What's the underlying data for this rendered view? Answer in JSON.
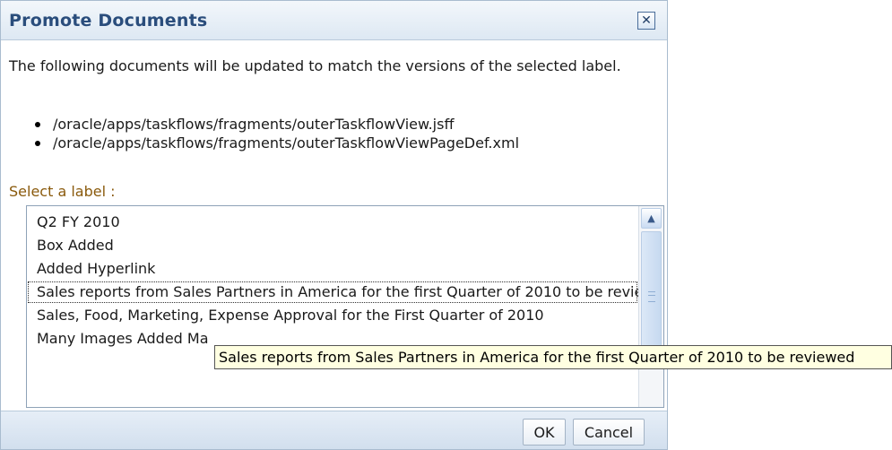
{
  "dialog": {
    "title": "Promote Documents",
    "close_icon": "close-icon",
    "description": "The following documents will be updated to match the versions of the selected label.",
    "documents": [
      "/oracle/apps/taskflows/fragments/outerTaskflowView.jsff",
      "/oracle/apps/taskflows/fragments/outerTaskflowViewPageDef.xml"
    ],
    "select_label": "Select a label :",
    "labels": [
      "Q2 FY 2010",
      "Box Added",
      "Added Hyperlink",
      "Sales reports from Sales Partners in America for the first Quarter of 2010 to be reviewed",
      "Sales, Food, Marketing, Expense Approval for the First Quarter of 2010",
      "Many Images Added Ma"
    ],
    "focused_label_index": 3,
    "tooltip": "Sales reports from Sales Partners in America for the first Quarter of 2010 to be reviewed",
    "buttons": {
      "ok": "OK",
      "cancel": "Cancel"
    }
  },
  "colors": {
    "title_text": "#2a4d7c",
    "select_label_text": "#8a5a0c",
    "tooltip_bg": "#ffffe1"
  }
}
